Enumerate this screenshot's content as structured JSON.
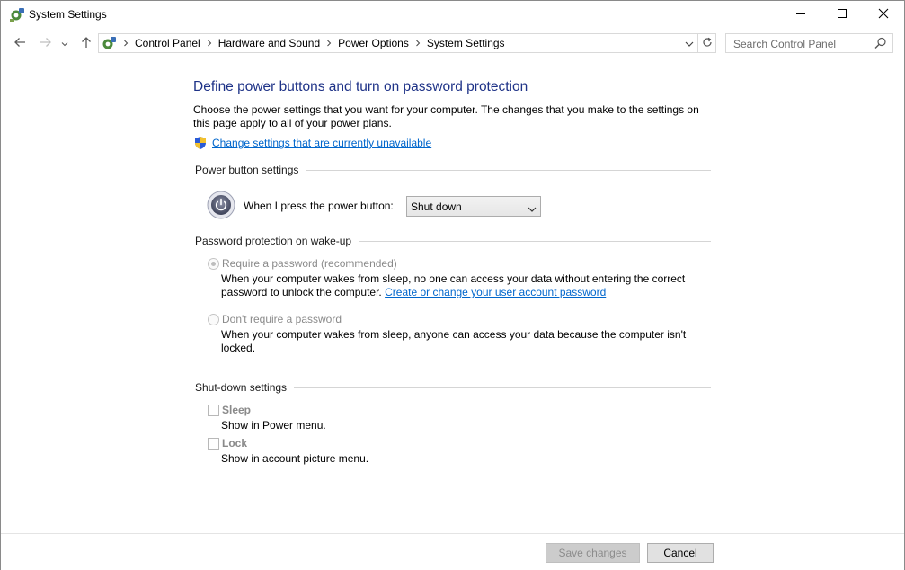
{
  "window": {
    "title": "System Settings"
  },
  "address_bar": {
    "crumbs": [
      "Control Panel",
      "Hardware and Sound",
      "Power Options",
      "System Settings"
    ]
  },
  "search": {
    "placeholder": "Search Control Panel"
  },
  "page": {
    "heading": "Define power buttons and turn on password protection",
    "intro": "Choose the power settings that you want for your computer. The changes that you make to the settings on this page apply to all of your power plans.",
    "change_link": "Change settings that are currently unavailable"
  },
  "power_buttons": {
    "section_label": "Power button settings",
    "power_button_label": "When I press the power button:",
    "power_button_value": "Shut down"
  },
  "password": {
    "section_label": "Password protection on wake-up",
    "require_label": "Require a password (recommended)",
    "require_desc": "When your computer wakes from sleep, no one can access your data without entering the correct password to unlock the computer.",
    "require_link": "Create or change your user account password",
    "no_require_label": "Don't require a password",
    "no_require_desc": "When your computer wakes from sleep, anyone can access your data because the computer isn't locked.",
    "selected": "require"
  },
  "shutdown": {
    "section_label": "Shut-down settings",
    "sleep_label": "Sleep",
    "sleep_desc": "Show in Power menu.",
    "sleep_checked": false,
    "lock_label": "Lock",
    "lock_desc": "Show in account picture menu.",
    "lock_checked": false
  },
  "footer": {
    "save_label": "Save changes",
    "cancel_label": "Cancel"
  },
  "colors": {
    "heading": "#1e3287",
    "link": "#0066cc",
    "disabled_text": "#8a8a8a"
  },
  "icons": [
    "control-panel-icon",
    "minimize-icon",
    "maximize-icon",
    "close-icon",
    "back-arrow-icon",
    "forward-arrow-icon",
    "recent-chevron-icon",
    "up-arrow-icon",
    "breadcrumb-chevron-icon",
    "dropdown-chevron-icon",
    "refresh-icon",
    "search-icon",
    "uac-shield-icon",
    "power-icon"
  ]
}
